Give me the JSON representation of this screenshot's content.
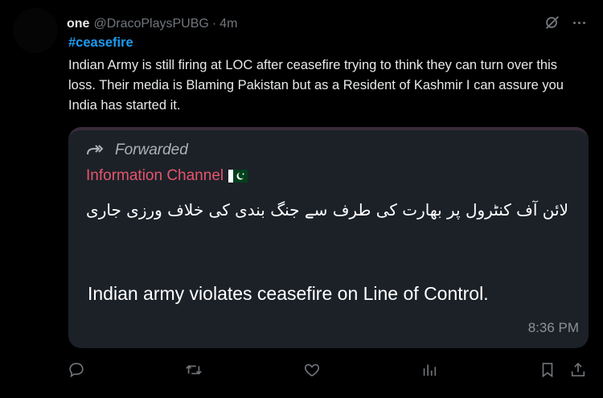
{
  "tweet": {
    "display_name": "one",
    "handle": "@DracoPlaysPUBG",
    "separator": "·",
    "time": "4m",
    "hashtag": "#ceasefire",
    "text": "Indian Army is still firing at LOC after ceasefire trying to think they can turn over this loss. Their media is Blaming Pakistan but as a Resident of Kashmir I can assure you India has started it."
  },
  "card": {
    "forwarded_label": "Forwarded",
    "channel_name": "Information Channel",
    "urdu_text": "لائن آف کنٹرول پر بھارت کی طرف سے جنگ بندی کی خلاف ورزی جاری",
    "english_text": "Indian army violates ceasefire on Line of Control.",
    "time": "8:36 PM"
  },
  "icons": {
    "reply": "reply-icon",
    "retweet": "retweet-icon",
    "like": "like-icon",
    "views": "views-icon",
    "bookmark": "bookmark-icon",
    "share": "share-icon",
    "grok": "grok-icon",
    "more": "more-icon",
    "forward": "forward-icon",
    "flag": "pakistan-flag-icon"
  },
  "colors": {
    "background": "#000000",
    "hashtag": "#1d9bf0",
    "channel_name": "#e5556c",
    "card_bg": "#1c2128",
    "muted": "#71767b"
  }
}
